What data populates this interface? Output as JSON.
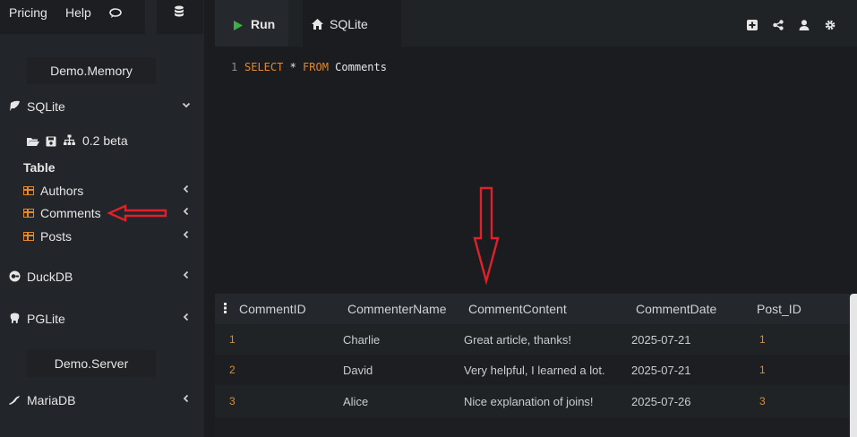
{
  "topnav": {
    "pricing": "Pricing",
    "help": "Help"
  },
  "sidebar": {
    "memory_heading": "Demo.Memory",
    "server_heading": "Demo.Server",
    "sqlite": {
      "label": "SQLite",
      "version": "0.2 beta",
      "table_heading": "Table"
    },
    "tables": [
      {
        "label": "Authors"
      },
      {
        "label": "Comments"
      },
      {
        "label": "Posts"
      }
    ],
    "duckdb": "DuckDB",
    "pglite": "PGLite",
    "mariadb": "MariaDB"
  },
  "tabs": {
    "run": "Run",
    "sqlite": "SQLite"
  },
  "editor": {
    "line_number": "1",
    "kw_select": "SELECT",
    "star": " * ",
    "kw_from": "FROM",
    "table": " Comments"
  },
  "results": {
    "columns": [
      "CommentID",
      "CommenterName",
      "CommentContent",
      "CommentDate",
      "Post_ID"
    ],
    "rows": [
      [
        "1",
        "Charlie",
        "Great article, thanks!",
        "2025-07-21",
        "1"
      ],
      [
        "2",
        "David",
        "Very helpful, I learned a lot.",
        "2025-07-21",
        "1"
      ],
      [
        "3",
        "Alice",
        "Nice explanation of joins!",
        "2025-07-26",
        "3"
      ]
    ]
  },
  "colors": {
    "accent": "#e08a2c",
    "annotation": "#e0202a",
    "run_green": "#3cb043"
  }
}
